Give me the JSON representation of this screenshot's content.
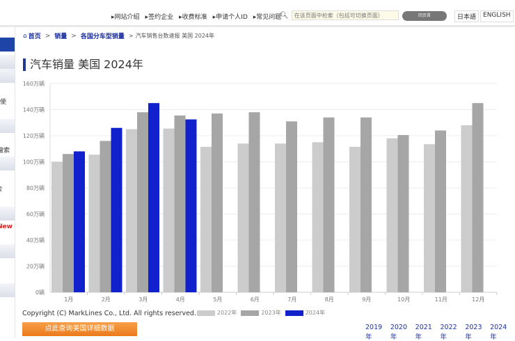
{
  "topnav": {
    "items": [
      "网站介绍",
      "签约企业",
      "收费标准",
      "申请个人ID",
      "常见问题"
    ],
    "search_placeholder": "在该页面中检索（包括可切换页面）",
    "search_button": "回页首",
    "lang": [
      "日本語",
      "ENGLISH"
    ]
  },
  "sidebar": {
    "fragments": [
      "使",
      "搜索",
      "索",
      "New"
    ]
  },
  "breadcrumb": {
    "home": "首页",
    "sep": ">",
    "level1": "销量",
    "level2": "各国分车型销量",
    "current": "汽车销售台数速报 美国 2024年"
  },
  "page_title": "汽车销量 美国 2024年",
  "chart_data": {
    "type": "bar",
    "title": "",
    "categories": [
      "1月",
      "2月",
      "3月",
      "4月",
      "5月",
      "6月",
      "7月",
      "8月",
      "9月",
      "10月",
      "11月",
      "12月"
    ],
    "ylim": [
      0,
      160
    ],
    "yticks": [
      "0辆",
      "20万辆",
      "40万辆",
      "60万辆",
      "80万辆",
      "100万辆",
      "120万辆",
      "140万辆",
      "160万辆"
    ],
    "unit": "万辆",
    "grid": true,
    "legend_position": "bottom",
    "series": [
      {
        "name": "2022年",
        "color": "#cccccc",
        "values": [
          100,
          105.5,
          125,
          125.5,
          111.5,
          114,
          114,
          115,
          111.5,
          118,
          113.5,
          128
        ]
      },
      {
        "name": "2023年",
        "color": "#a6a6a6",
        "values": [
          106,
          116,
          138,
          135.5,
          137,
          138,
          131,
          134,
          134,
          120.5,
          124,
          145
        ]
      },
      {
        "name": "2024年",
        "color": "#1122cc",
        "values": [
          108,
          126,
          145,
          132.5,
          null,
          null,
          null,
          null,
          null,
          null,
          null,
          null
        ]
      }
    ]
  },
  "footer": {
    "copyright": "Copyright (C) MarkLines Co., Ltd. All rights reserved.",
    "detail_button": "点此查询美国详细数据",
    "years": [
      "2019年",
      "2020年",
      "2021年",
      "2022年",
      "2023年",
      "2024年"
    ]
  },
  "colors": {
    "accent": "#1a2fa0",
    "orange": "#ec7a1c"
  }
}
